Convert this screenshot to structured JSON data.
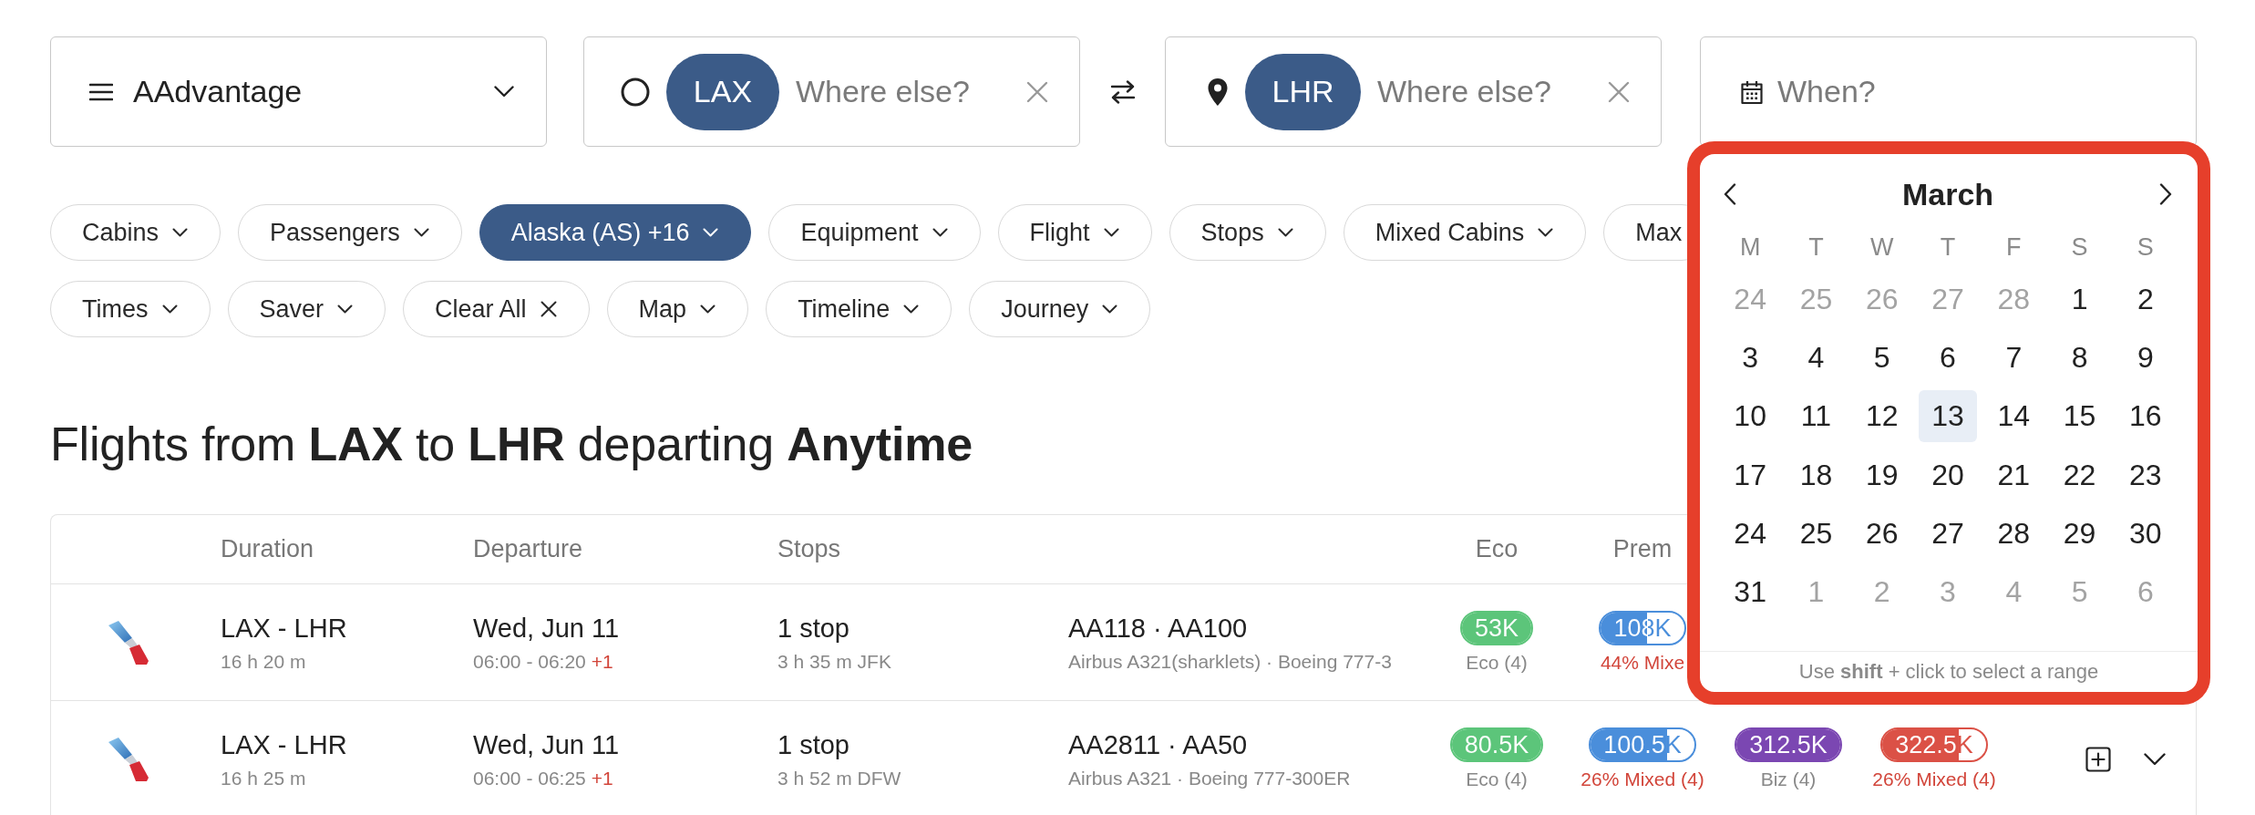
{
  "program_select": {
    "value": "AAdvantage"
  },
  "origin": {
    "airport": "LAX",
    "placeholder": "Where else?"
  },
  "destination": {
    "airport": "LHR",
    "placeholder": "Where else?"
  },
  "date": {
    "placeholder": "When?"
  },
  "filter_rows": [
    [
      {
        "label": "Cabins",
        "kind": "dropdown",
        "selected": false
      },
      {
        "label": "Passengers",
        "kind": "dropdown",
        "selected": false
      },
      {
        "label": "Alaska (AS) +16",
        "kind": "dropdown",
        "selected": true
      },
      {
        "label": "Equipment",
        "kind": "dropdown",
        "selected": false
      },
      {
        "label": "Flight",
        "kind": "dropdown",
        "selected": false
      },
      {
        "label": "Stops",
        "kind": "dropdown",
        "selected": false
      },
      {
        "label": "Mixed Cabins",
        "kind": "dropdown",
        "selected": false
      },
      {
        "label": "Max",
        "kind": "plain",
        "selected": false
      }
    ],
    [
      {
        "label": "Times",
        "kind": "dropdown",
        "selected": false
      },
      {
        "label": "Saver",
        "kind": "dropdown",
        "selected": false
      },
      {
        "label": "Clear All",
        "kind": "clear",
        "selected": false
      },
      {
        "label": "Map",
        "kind": "dropdown",
        "selected": false
      },
      {
        "label": "Timeline",
        "kind": "dropdown",
        "selected": false
      },
      {
        "label": "Journey",
        "kind": "dropdown",
        "selected": false
      }
    ]
  ],
  "heading": "Flights from **LAX** to **LHR** departing **Anytime**",
  "table": {
    "columns": [
      "Duration",
      "Departure",
      "Stops",
      "Eco",
      "Prem"
    ],
    "rows": [
      {
        "route": "LAX - LHR",
        "duration": "16 h 20 m",
        "date": "Wed, Jun 11",
        "time": "06:00 - 06:20",
        "day_offset": "+1",
        "stops": "1 stop",
        "layover": "3 h 35 m JFK",
        "flights": "AA118 · AA100",
        "aircraft": "Airbus A321(sharklets) · Boeing 777-3",
        "fares": [
          {
            "price": "53K",
            "color": "#5cc57a",
            "level": 1,
            "note": "Eco (4)",
            "mixed": false
          },
          {
            "price": "108K",
            "color": "#4a8edb",
            "level": 0.56,
            "note": "44% Mixe",
            "mixed": true
          }
        ]
      },
      {
        "route": "LAX - LHR",
        "duration": "16 h 25 m",
        "date": "Wed, Jun 11",
        "time": "06:00 - 06:25",
        "day_offset": "+1",
        "stops": "1 stop",
        "layover": "3 h 52 m DFW",
        "flights": "AA2811 · AA50",
        "aircraft": "Airbus A321 · Boeing 777-300ER",
        "fares": [
          {
            "price": "80.5K",
            "color": "#5cc57a",
            "level": 1,
            "note": "Eco (4)",
            "mixed": false
          },
          {
            "price": "100.5K",
            "color": "#4a8edb",
            "level": 0.74,
            "note": "26% Mixed (4)",
            "mixed": true
          },
          {
            "price": "312.5K",
            "color": "#7b47b2",
            "level": 1,
            "note": "Biz (4)",
            "mixed": false
          },
          {
            "price": "322.5K",
            "color": "#db5146",
            "level": 0.74,
            "note": "26% Mixed (4)",
            "mixed": true
          }
        ],
        "expanded": false
      }
    ]
  },
  "calendar": {
    "month": "March",
    "weekdays": [
      "M",
      "T",
      "W",
      "T",
      "F",
      "S",
      "S"
    ],
    "weeks": [
      [
        {
          "day": "24",
          "outside_month": true,
          "today": false
        },
        {
          "day": "25",
          "outside_month": true,
          "today": false
        },
        {
          "day": "26",
          "outside_month": true,
          "today": false
        },
        {
          "day": "27",
          "outside_month": true,
          "today": false
        },
        {
          "day": "28",
          "outside_month": true,
          "today": false
        },
        {
          "day": "1",
          "outside_month": false,
          "today": false
        },
        {
          "day": "2",
          "outside_month": false,
          "today": false
        }
      ],
      [
        {
          "day": "3",
          "outside_month": false,
          "today": false
        },
        {
          "day": "4",
          "outside_month": false,
          "today": false
        },
        {
          "day": "5",
          "outside_month": false,
          "today": false
        },
        {
          "day": "6",
          "outside_month": false,
          "today": false
        },
        {
          "day": "7",
          "outside_month": false,
          "today": false
        },
        {
          "day": "8",
          "outside_month": false,
          "today": false
        },
        {
          "day": "9",
          "outside_month": false,
          "today": false
        }
      ],
      [
        {
          "day": "10",
          "outside_month": false,
          "today": false
        },
        {
          "day": "11",
          "outside_month": false,
          "today": false
        },
        {
          "day": "12",
          "outside_month": false,
          "today": false
        },
        {
          "day": "13",
          "outside_month": false,
          "today": true
        },
        {
          "day": "14",
          "outside_month": false,
          "today": false
        },
        {
          "day": "15",
          "outside_month": false,
          "today": false
        },
        {
          "day": "16",
          "outside_month": false,
          "today": false
        }
      ],
      [
        {
          "day": "17",
          "outside_month": false,
          "today": false
        },
        {
          "day": "18",
          "outside_month": false,
          "today": false
        },
        {
          "day": "19",
          "outside_month": false,
          "today": false
        },
        {
          "day": "20",
          "outside_month": false,
          "today": false
        },
        {
          "day": "21",
          "outside_month": false,
          "today": false
        },
        {
          "day": "22",
          "outside_month": false,
          "today": false
        },
        {
          "day": "23",
          "outside_month": false,
          "today": false
        }
      ],
      [
        {
          "day": "24",
          "outside_month": false,
          "today": false
        },
        {
          "day": "25",
          "outside_month": false,
          "today": false
        },
        {
          "day": "26",
          "outside_month": false,
          "today": false
        },
        {
          "day": "27",
          "outside_month": false,
          "today": false
        },
        {
          "day": "28",
          "outside_month": false,
          "today": false
        },
        {
          "day": "29",
          "outside_month": false,
          "today": false
        },
        {
          "day": "30",
          "outside_month": false,
          "today": false
        }
      ],
      [
        {
          "day": "31",
          "outside_month": false,
          "today": false
        },
        {
          "day": "1",
          "outside_month": true,
          "today": false
        },
        {
          "day": "2",
          "outside_month": true,
          "today": false
        },
        {
          "day": "3",
          "outside_month": true,
          "today": false
        },
        {
          "day": "4",
          "outside_month": true,
          "today": false
        },
        {
          "day": "5",
          "outside_month": true,
          "today": false
        },
        {
          "day": "6",
          "outside_month": true,
          "today": false
        }
      ]
    ],
    "hint": "Use **shift** + click to select a range"
  }
}
